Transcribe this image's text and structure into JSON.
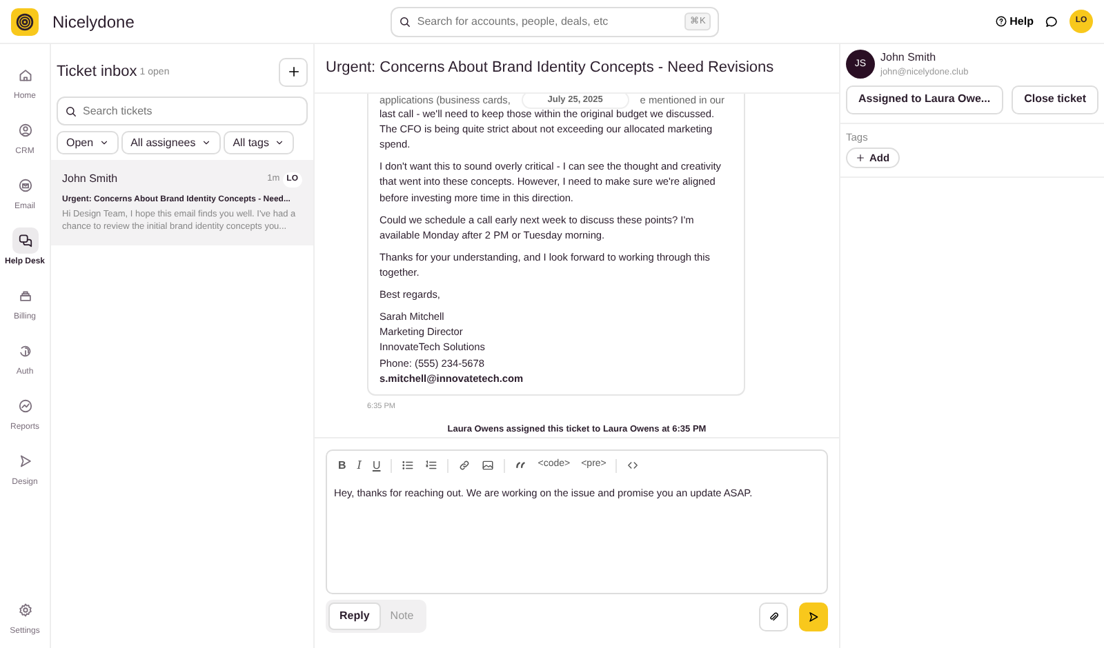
{
  "app": {
    "name": "Nicelydone"
  },
  "search": {
    "placeholder": "Search for accounts, people, deals, etc",
    "shortcut": "⌘K"
  },
  "header": {
    "help": "Help",
    "avatar": "LO"
  },
  "nav": {
    "items": [
      {
        "label": "Home",
        "kind": "home",
        "selected": false
      },
      {
        "label": "CRM",
        "kind": "user",
        "selected": false
      },
      {
        "label": "Email",
        "kind": "mail",
        "selected": false
      },
      {
        "label": "Help Desk",
        "kind": "chat",
        "selected": true
      },
      {
        "label": "Billing",
        "kind": "billing",
        "selected": false
      },
      {
        "label": "Auth",
        "kind": "auth",
        "selected": false
      },
      {
        "label": "Reports",
        "kind": "chart",
        "selected": false
      },
      {
        "label": "Design",
        "kind": "design",
        "selected": false
      }
    ],
    "settings": "Settings"
  },
  "inbox": {
    "title": "Ticket inbox",
    "count": "1 open",
    "search_placeholder": "Search tickets",
    "filters": [
      "Open",
      "All assignees",
      "All tags"
    ],
    "tickets": [
      {
        "name": "John Smith",
        "time": "1m",
        "assignee": "LO",
        "subject": "Urgent: Concerns About Brand Identity Concepts - Need...",
        "preview": "Hi Design Team, I hope this email finds you well. I've had a chance to review the initial brand identity concepts you...",
        "selected": true
      }
    ]
  },
  "ticket": {
    "title": "Urgent: Concerns About Brand Identity Concepts - Need Revisions",
    "date": "July 25, 2025",
    "partial_line": [
      "applications (business cards,",
      "e mentioned in our"
    ],
    "paragraphs": [
      "last call - we'll need to keep those within the original budget we discussed. The CFO is being quite strict about not exceeding our allocated marketing spend.",
      "I don't want this to sound overly critical - I can see the thought and creativity that went into these concepts. However, I need to make sure we're aligned before investing more time in this direction.",
      "Could we schedule a call early next week to discuss these points? I'm available Monday after 2 PM or Tuesday morning.",
      "Thanks for your understanding, and I look forward to working through this together.",
      "Best regards,"
    ],
    "signature": [
      "Sarah Mitchell",
      "Marketing Director",
      "InnovateTech Solutions",
      "Phone: (555) 234-5678"
    ],
    "email": "s.mitchell@innovatetech.com",
    "time": "6:35 PM",
    "event": "Laura Owens assigned this ticket to Laura Owens at 6:35 PM"
  },
  "composer": {
    "toolbar": [
      {
        "kind": "bold",
        "label": "B"
      },
      {
        "kind": "italic",
        "label": "I"
      },
      {
        "kind": "underline",
        "label": "U"
      },
      {
        "kind": "bullet-list"
      },
      {
        "kind": "numbered-list"
      },
      {
        "kind": "link"
      },
      {
        "kind": "image"
      },
      {
        "kind": "quote"
      },
      {
        "kind": "tag",
        "label": "<code>"
      },
      {
        "kind": "tag",
        "label": "<pre>"
      },
      {
        "kind": "code"
      }
    ],
    "text": "Hey, thanks for reaching out. We are working on the issue and promise you an update ASAP.",
    "tabs": [
      {
        "label": "Reply",
        "selected": true
      },
      {
        "label": "Note",
        "selected": false
      }
    ]
  },
  "contact": {
    "initials": "JS",
    "name": "John Smith",
    "email": "john@nicelydone.club",
    "buttons": [
      "Assigned to Laura Owe...",
      "Close ticket"
    ],
    "tags_label": "Tags",
    "add": "Add"
  }
}
